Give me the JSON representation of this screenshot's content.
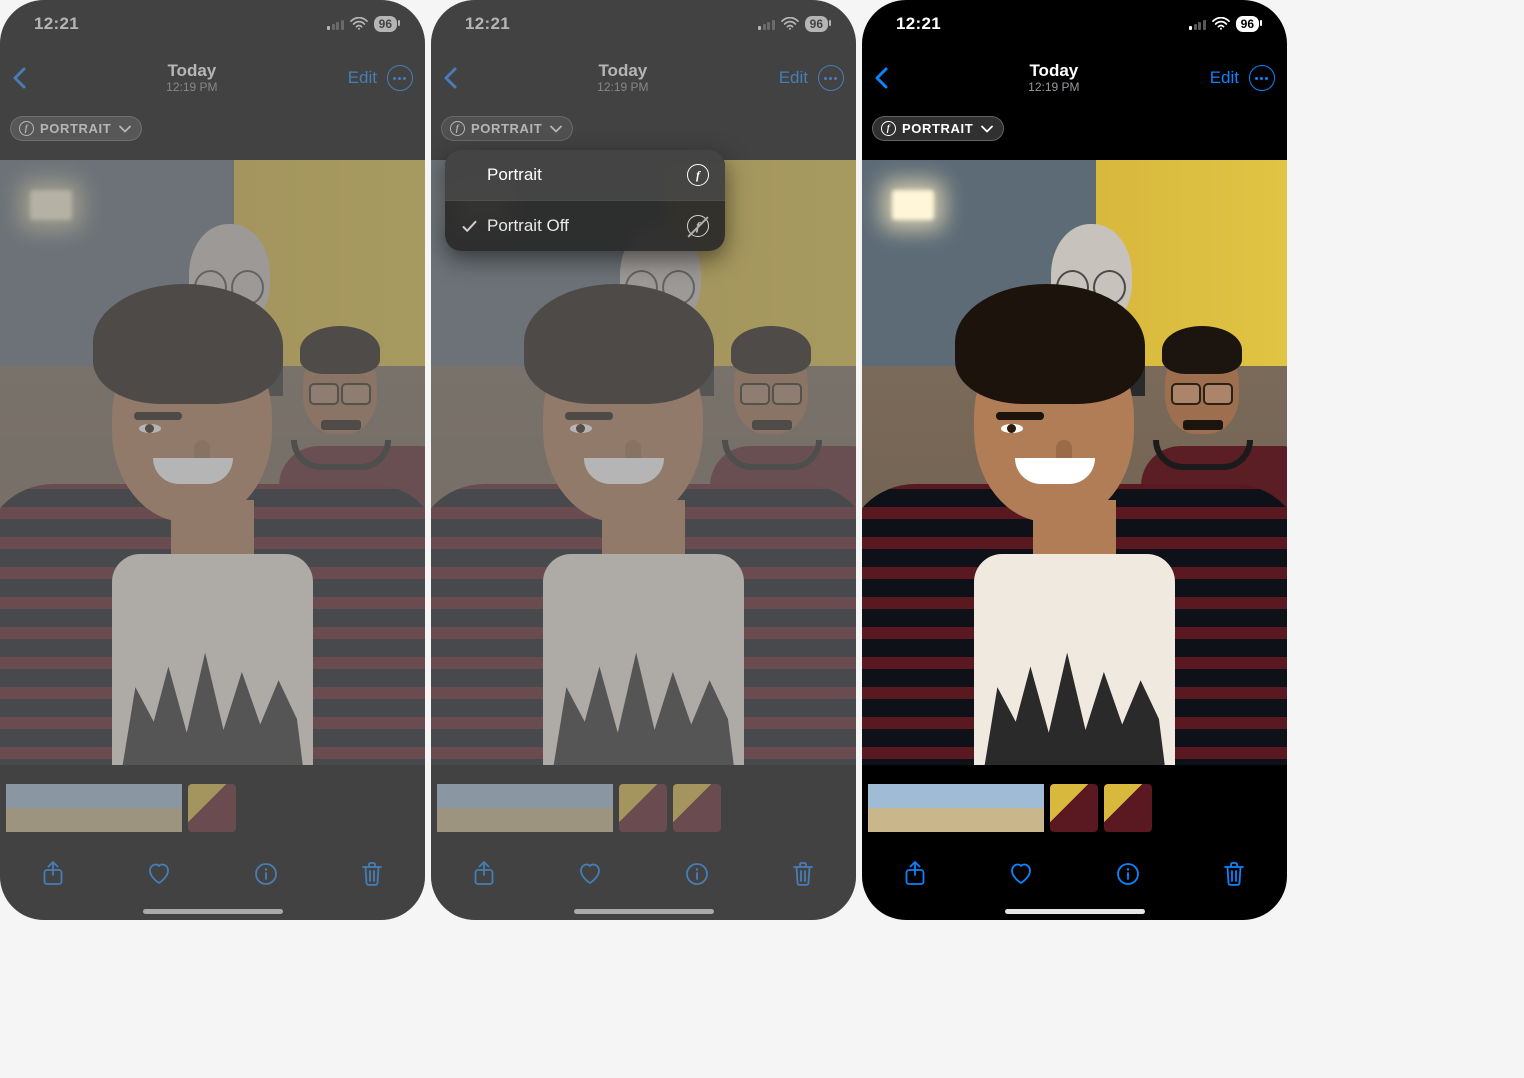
{
  "status": {
    "time": "12:21",
    "battery": "96"
  },
  "nav": {
    "title": "Today",
    "subtitle": "12:19 PM",
    "edit": "Edit"
  },
  "badge": {
    "label": "PORTRAIT"
  },
  "menu": {
    "items": [
      {
        "label": "Portrait",
        "selected": false,
        "strike": false
      },
      {
        "label": "Portrait Off",
        "selected": true,
        "strike": true
      }
    ]
  }
}
